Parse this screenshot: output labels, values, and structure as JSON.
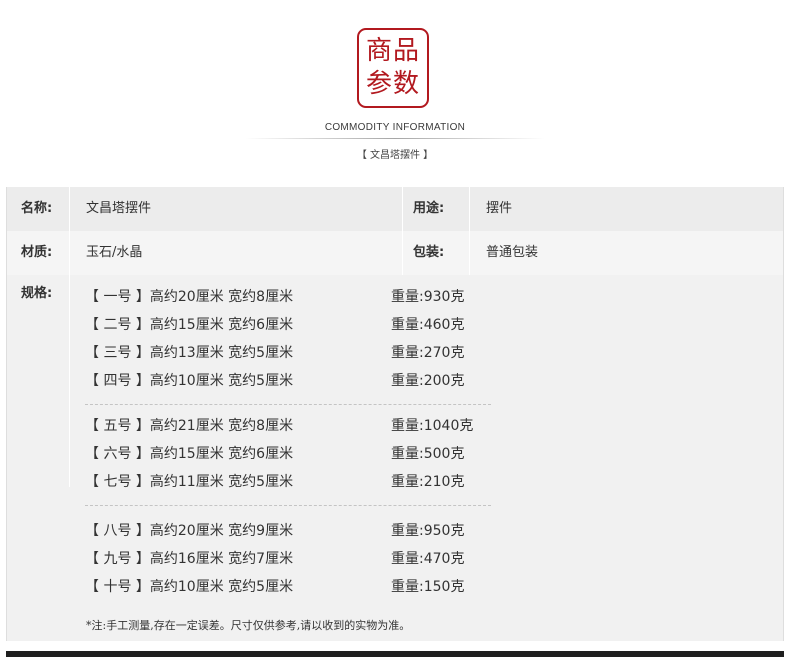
{
  "header": {
    "seal_line1": "商品",
    "seal_line2": "参数",
    "subtitle_en": "COMMODITY INFORMATION",
    "subtitle_cn": "【 文昌塔摆件 】"
  },
  "params": {
    "name_label": "名称:",
    "name_value": "文昌塔摆件",
    "usage_label": "用途:",
    "usage_value": "摆件",
    "material_label": "材质:",
    "material_value": "玉石/水晶",
    "packaging_label": "包装:",
    "packaging_value": "普通包装",
    "spec_label": "规格:"
  },
  "specs": [
    {
      "size": "【 一号 】高约20厘米 宽约8厘米",
      "weight": "重量:930克"
    },
    {
      "size": "【 二号 】高约15厘米 宽约6厘米",
      "weight": "重量:460克"
    },
    {
      "size": "【 三号 】高约13厘米 宽约5厘米",
      "weight": "重量:270克"
    },
    {
      "size": "【 四号 】高约10厘米 宽约5厘米",
      "weight": "重量:200克"
    },
    {
      "size": "【 五号 】高约21厘米 宽约8厘米",
      "weight": "重量:1040克"
    },
    {
      "size": "【 六号 】高约15厘米 宽约6厘米",
      "weight": "重量:500克"
    },
    {
      "size": "【 七号 】高约11厘米 宽约5厘米",
      "weight": "重量:210克"
    },
    {
      "size": "【 八号 】高约20厘米 宽约9厘米",
      "weight": "重量:950克"
    },
    {
      "size": "【 九号 】高约16厘米 宽约7厘米",
      "weight": "重量:470克"
    },
    {
      "size": "【 十号 】高约10厘米 宽约5厘米",
      "weight": "重量:150克"
    }
  ],
  "note": "*注:手工测量,存在一定误差。尺寸仅供参考,请以收到的实物为准。",
  "colors": {
    "seal": "#b2191f",
    "table_bg": "#f1f1f1",
    "bottom_bar": "#1f1f1f"
  }
}
